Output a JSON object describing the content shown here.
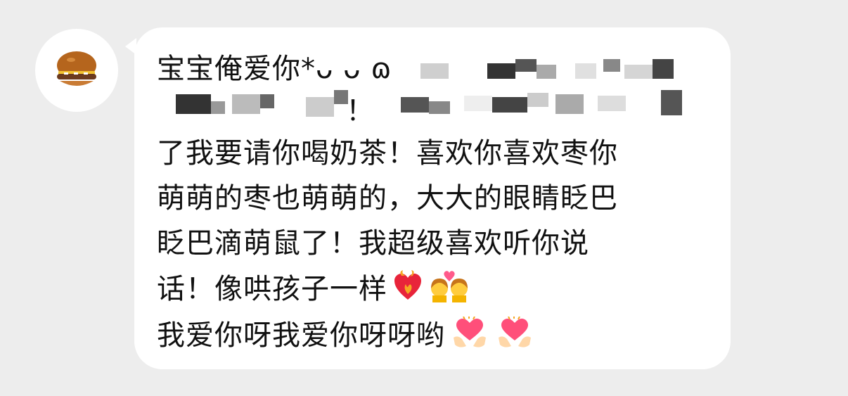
{
  "chat": {
    "avatar_icon": "burger-icon",
    "message": {
      "lines": [
        "宝宝俺爱你*ᴗ ᴗ ɷ",
        "",
        "！",
        "了我要请你喝奶茶！喜欢你喜欢枣你",
        "萌萌的枣也萌萌的，大大的眼睛眨巴",
        "眨巴滴萌鼠了！我超级喜欢听你说",
        "话！像哄孩子一样",
        "我爱你呀我爱你呀呀哟"
      ],
      "line7_emojis": [
        "heart-on-fire-icon",
        "couple-with-heart-icon"
      ],
      "line8_emojis": [
        "heart-hands-icon",
        "heart-hands-icon"
      ],
      "censored": true
    },
    "colors": {
      "background": "#ededed",
      "bubble": "#ffffff",
      "text": "#111111"
    }
  }
}
